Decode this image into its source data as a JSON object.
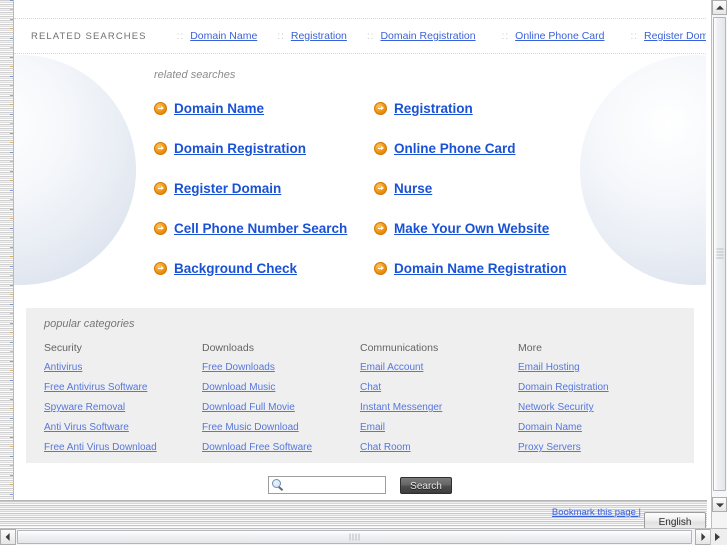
{
  "topbar": {
    "heading": "RELATED SEARCHES",
    "separator": "::",
    "links": [
      "Domain Name",
      "Registration",
      "Domain Registration",
      "Online Phone Card",
      "Register Domain"
    ]
  },
  "related": {
    "label": "related searches",
    "items": [
      "Domain Name",
      "Registration",
      "Domain Registration",
      "Online Phone Card",
      "Register Domain",
      "Nurse",
      "Cell Phone Number Search",
      "Make Your Own Website",
      "Background Check",
      "Domain Name Registration"
    ]
  },
  "categories": {
    "title": "popular categories",
    "columns": [
      {
        "heading": "Security",
        "links": [
          "Antivirus",
          "Free Antivirus Software",
          "Spyware Removal",
          "Anti Virus Software",
          "Free Anti Virus Download"
        ]
      },
      {
        "heading": "Downloads",
        "links": [
          "Free Downloads",
          "Download Music",
          "Download Full Movie",
          "Free Music Download",
          "Download Free Software"
        ]
      },
      {
        "heading": "Communications",
        "links": [
          "Email Account",
          "Chat",
          "Instant Messenger",
          "Email",
          "Chat Room"
        ]
      },
      {
        "heading": "More",
        "links": [
          "Email Hosting",
          "Domain Registration",
          "Network Security",
          "Domain Name",
          "Proxy Servers"
        ]
      }
    ]
  },
  "search": {
    "value": "",
    "placeholder": "",
    "button_label": "Search",
    "icon": "magnifier-icon"
  },
  "statusbar": {
    "bookmark_label": "Bookmark this page |",
    "language": "English"
  },
  "colors": {
    "link_blue": "#1a52d6",
    "top_link_blue": "#3a62d8",
    "category_link_blue": "#5577dd",
    "arrow_orange": "#f0920f",
    "panel_gray": "#efefef",
    "muted_text": "#8c8c8c"
  }
}
